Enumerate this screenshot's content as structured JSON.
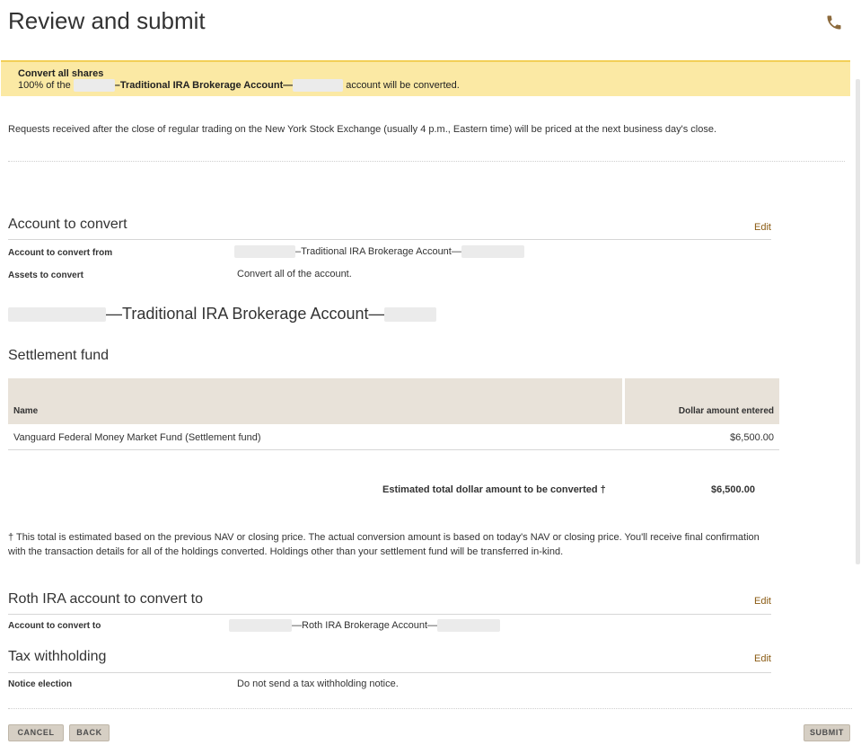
{
  "page": {
    "title": "Review and submit"
  },
  "banner": {
    "title": "Convert all shares",
    "prefix": "100% of the",
    "account_name": "–Traditional IRA Brokerage Account—",
    "suffix": "account will be converted."
  },
  "notice": "Requests received after the close of regular trading on the New York Stock Exchange (usually 4 p.m., Eastern time) will be priced at the next business day's close.",
  "account_to_convert": {
    "heading": "Account to convert",
    "edit": "Edit",
    "from_label": "Account to convert from",
    "from_value": "–Traditional IRA Brokerage Account—",
    "assets_label": "Assets to convert",
    "assets_value": "Convert all of the account."
  },
  "account_heading": {
    "text": "—Traditional IRA Brokerage Account—"
  },
  "settlement": {
    "heading": "Settlement fund",
    "col_name": "Name",
    "col_amount": "Dollar amount entered",
    "rows": [
      {
        "name": "Vanguard Federal Money Market Fund  (Settlement fund)",
        "amount": "$6,500.00"
      }
    ],
    "total_label": "Estimated total dollar amount to be converted †",
    "total_value": "$6,500.00"
  },
  "footnote": "† This total is estimated based on the previous NAV or closing price. The actual conversion amount is based on today's NAV or closing price. You'll receive final confirmation with the transaction details for all of the holdings converted. Holdings other than your settlement fund will be transferred in-kind.",
  "roth": {
    "heading": "Roth IRA account to convert to",
    "edit": "Edit",
    "label": "Account to convert to",
    "value": "—Roth IRA Brokerage Account—"
  },
  "tax": {
    "heading": "Tax withholding",
    "edit": "Edit",
    "label": "Notice election",
    "value": "Do not send a tax withholding notice."
  },
  "buttons": {
    "cancel": "CANCEL",
    "back": "BACK",
    "submit": "SUBMIT"
  },
  "icons": {
    "phone": "phone-icon"
  },
  "colors": {
    "banner_bg": "#fbe9a4",
    "banner_border": "#f2cf57",
    "link": "#8a5a12",
    "table_header": "#e8e2d9",
    "button_bg": "#d6cfc4"
  }
}
